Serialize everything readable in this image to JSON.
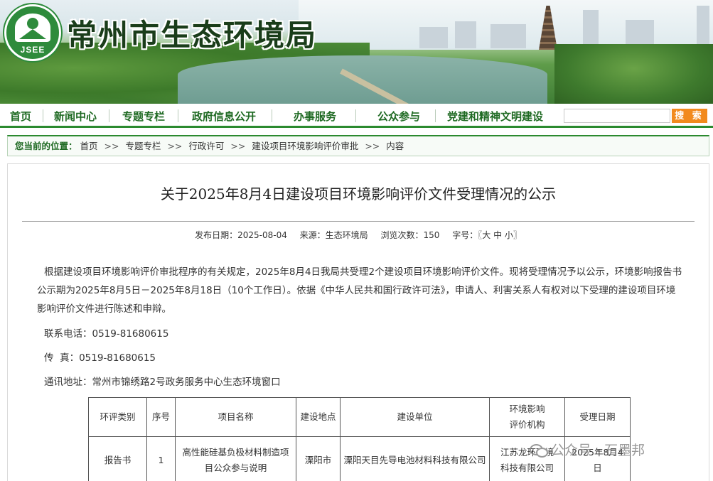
{
  "site": {
    "logo_text": "JSEE",
    "title": "常州市生态环境局"
  },
  "nav": {
    "items": [
      "首页",
      "新闻中心",
      "专题专栏",
      "政府信息公开",
      "办事服务",
      "公众参与",
      "党建和精神文明建设"
    ],
    "search_placeholder": "",
    "search_button": "搜 索"
  },
  "breadcrumb": {
    "label": "您当前的位置：",
    "items": [
      "首页",
      "专题专栏",
      "行政许可",
      "建设项目环境影响评价审批",
      "内容"
    ],
    "separator": ">>"
  },
  "article": {
    "title": "关于2025年8月4日建设项目环境影响评价文件受理情况的公示",
    "meta": {
      "date": "发布日期：2025-08-04",
      "source": "来源：生态环境局",
      "views": "浏览次数：150",
      "fontsize": "字号：〖大 中 小〗"
    },
    "paragraph": "根据建设项目环境影响评价审批程序的有关规定，2025年8月4日我局共受理2个建设项目环境影响评价文件。现将受理情况予以公示，环境影响报告书公示期为2025年8月5日－2025年8月18日（10个工作日）。依据《中华人民共和国行政许可法》，申请人、利害关系人有权对以下受理的建设项目环境影响评价文件进行陈述和申辩。",
    "phone": "联系电话：0519-81680615",
    "fax": "传  真：0519-81680615",
    "address": "通讯地址：常州市锦绣路2号政务服务中心生态环境窗口"
  },
  "table": {
    "headers": [
      "环评类别",
      "序号",
      "项目名称",
      "建设地点",
      "建设单位",
      "环境影响评价机构",
      "受理日期"
    ],
    "rows": [
      {
        "type": "报告书",
        "no": "1",
        "name": "高性能硅基负极材料制造项目公众参与说明",
        "location": "溧阳市",
        "unit": "溧阳天目先导电池材料科技有限公司",
        "agency": "江苏龙环环境科技有限公司",
        "date": "2025年8月4日"
      }
    ]
  },
  "watermark": {
    "text": "公众号 · 石墨邦"
  }
}
